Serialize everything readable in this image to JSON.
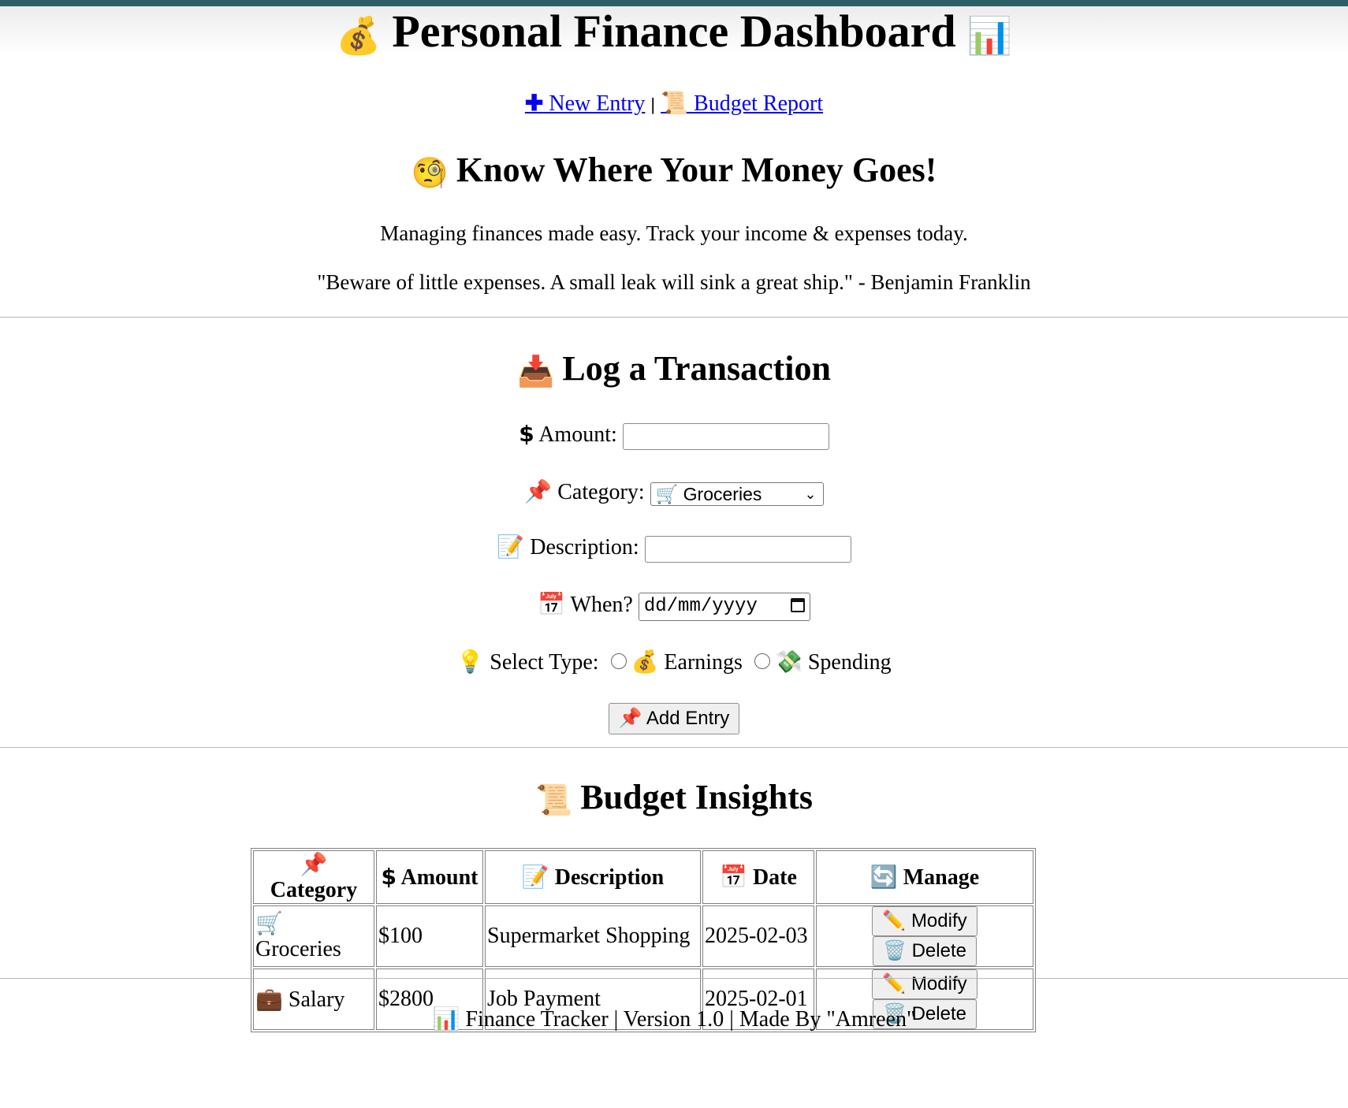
{
  "header": {
    "title": "Personal Finance Dashboard",
    "nav": {
      "new_entry": "New Entry",
      "separator": "|",
      "budget_report": "Budget Report"
    }
  },
  "hero": {
    "tagline": "Know Where Your Money Goes!",
    "intro": "Managing finances made easy. Track your income & expenses today.",
    "quote": "\"Beware of little expenses. A small leak will sink a great ship.\" - Benjamin Franklin"
  },
  "form": {
    "title": "Log a Transaction",
    "amount_label": "Amount:",
    "amount_value": "",
    "category_label": "Category:",
    "category_selected": "Groceries",
    "description_label": "Description:",
    "description_value": "",
    "date_label": "When?",
    "date_placeholder": "dd/mm/yyyy",
    "type_label": "Select Type:",
    "type_options": [
      "Earnings",
      "Spending"
    ],
    "submit_label": "Add Entry"
  },
  "insights": {
    "title": "Budget Insights",
    "columns": [
      "Category",
      "Amount",
      "Description",
      "Date",
      "Manage"
    ],
    "rows": [
      {
        "category": "Groceries",
        "amount": "$100",
        "description": "Supermarket Shopping",
        "date": "2025-02-03"
      },
      {
        "category": "Salary",
        "amount": "$2800",
        "description": "Job Payment",
        "date": "2025-02-01"
      }
    ],
    "modify_label": "Modify",
    "delete_label": "Delete"
  },
  "footer": {
    "text": "Finance Tracker | Version 1.0 | Made By \"Amreen\""
  },
  "icons": {
    "title_left": "money-bag-icon",
    "title_right": "bar-chart-icon",
    "new_entry": "plus-icon",
    "budget_report": "scroll-icon",
    "tagline": "monocle-face-icon",
    "form_title": "inbox-tray-icon",
    "amount": "dollar-sign-icon",
    "category": "pushpin-icon",
    "description": "memo-icon",
    "date": "calendar-icon",
    "type": "light-bulb-icon",
    "earnings": "money-bag-icon",
    "spending": "money-with-wings-icon",
    "add_entry": "pushpin-icon",
    "insights_title": "scroll-icon",
    "manage": "refresh-icon",
    "groceries": "shopping-cart-icon",
    "salary": "briefcase-icon",
    "modify": "pencil-icon",
    "delete": "wastebasket-icon",
    "footer": "bar-chart-icon"
  },
  "colors": {
    "top_bar": "#2c5f66",
    "link": "#0000ee"
  }
}
